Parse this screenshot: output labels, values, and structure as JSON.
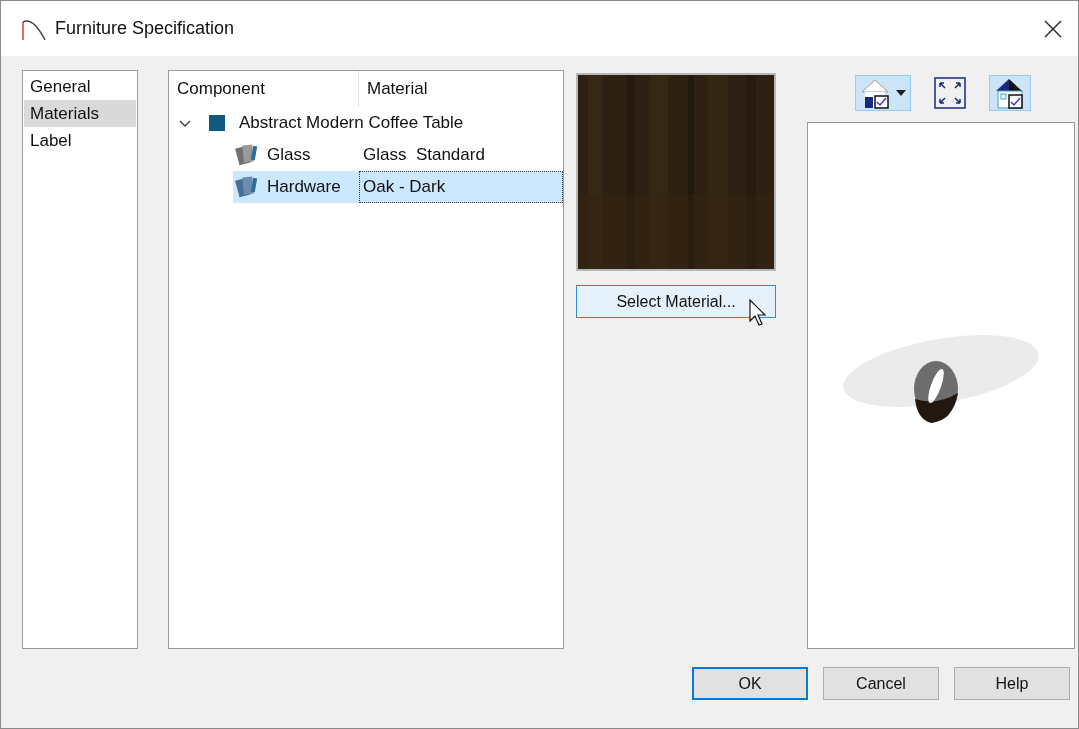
{
  "window": {
    "title": "Furniture Specification"
  },
  "sidebar": {
    "items": [
      {
        "label": "General",
        "selected": false
      },
      {
        "label": "Materials",
        "selected": true
      },
      {
        "label": "Label",
        "selected": false
      }
    ]
  },
  "tree": {
    "columns": [
      "Component",
      "Material"
    ],
    "root": {
      "label": "Abstract Modern Coffee Table",
      "expanded": true,
      "children": [
        {
          "component": "Glass",
          "material": "Glass  Standard",
          "selected": false
        },
        {
          "component": "Hardware",
          "material": "Oak - Dark",
          "selected": true
        }
      ]
    }
  },
  "select_button": "Select Material...",
  "toolbar": {
    "buttons": [
      {
        "kind": "house-dropdown",
        "selected": true
      },
      {
        "kind": "fit",
        "selected": false
      },
      {
        "kind": "house-split",
        "selected": true
      }
    ]
  },
  "dialog_buttons": [
    {
      "label": "OK",
      "default": true
    },
    {
      "label": "Cancel",
      "default": false
    },
    {
      "label": "Help",
      "default": false
    }
  ]
}
